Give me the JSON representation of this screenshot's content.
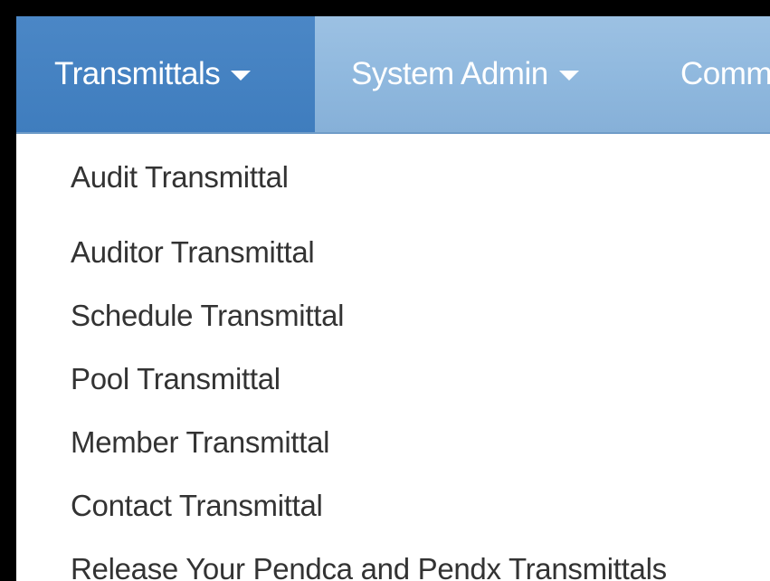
{
  "nav": {
    "items": [
      {
        "label": "Transmittals",
        "active": true
      },
      {
        "label": "System Admin",
        "active": false
      },
      {
        "label": "Comm",
        "active": false
      }
    ]
  },
  "dropdown": {
    "items": [
      {
        "label": "Audit Transmittal"
      },
      {
        "label": "Auditor Transmittal"
      },
      {
        "label": "Schedule Transmittal"
      },
      {
        "label": "Pool Transmittal"
      },
      {
        "label": "Member Transmittal"
      },
      {
        "label": "Contact Transmittal"
      },
      {
        "label": "Release Your Pendca and Pendx Transmittals"
      }
    ]
  },
  "colors": {
    "navbar_bg": "#8fb8de",
    "active_tab_bg": "#4281c1",
    "menu_text": "#333333",
    "nav_text": "#ffffff"
  },
  "icons": {
    "caret": "chevron-down-icon"
  }
}
